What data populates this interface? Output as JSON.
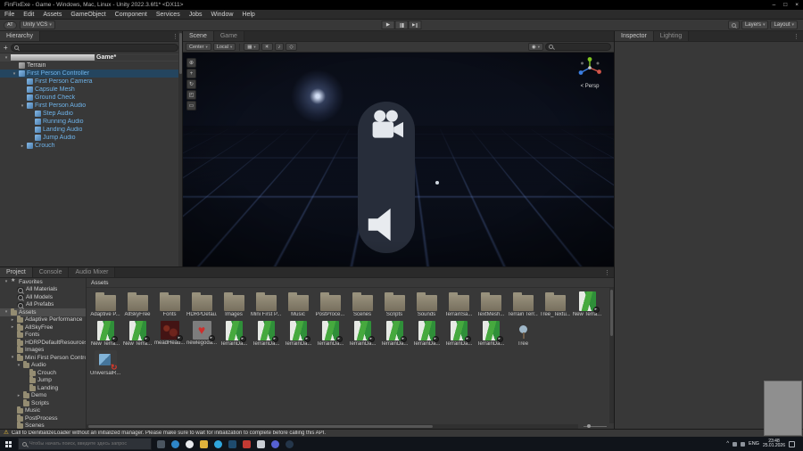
{
  "window": {
    "title": "FinFixExe - Game - Windows, Mac, Linux - Unity 2022.3.6f1* <DX11>",
    "controls": {
      "minimize": "–",
      "maximize": "□",
      "close": "×"
    },
    "menus": [
      "File",
      "Edit",
      "Assets",
      "GameObject",
      "Component",
      "Services",
      "Jobs",
      "Window",
      "Help"
    ]
  },
  "toolbar": {
    "account": "AT",
    "vcs": "Unity VCS",
    "layers": "Layers",
    "layout": "Layout"
  },
  "icons": {
    "play": "▶",
    "warning": "⚠",
    "more": "⋮",
    "grid": "▦",
    "lighting": "☀",
    "audio": "♪",
    "effects": "◇",
    "gizmos": "◉",
    "view_tool": "⊕",
    "move_tool": "+",
    "rotate_tool": "↻",
    "scale_tool": "◰",
    "rect_tool": "▭"
  },
  "hierarchy": {
    "tab": "Hierarchy",
    "add_button": "+",
    "items": [
      {
        "label": "Game*",
        "indent": 0,
        "arrow": "▾",
        "type": "scene",
        "color": "scene",
        "sel": "scenerow"
      },
      {
        "label": "Terrain",
        "indent": 1,
        "arrow": "",
        "type": "cube",
        "color": "plain"
      },
      {
        "label": "First Person Controller",
        "indent": 1,
        "arrow": "▾",
        "type": "prefab",
        "color": "prefab",
        "sel": "selrow"
      },
      {
        "label": "First Person Camera",
        "indent": 2,
        "arrow": "",
        "type": "prefab",
        "color": "prefab"
      },
      {
        "label": "Capsule Mesh",
        "indent": 2,
        "arrow": "",
        "type": "prefab",
        "color": "prefab"
      },
      {
        "label": "Ground Check",
        "indent": 2,
        "arrow": "",
        "type": "prefab",
        "color": "prefab"
      },
      {
        "label": "First Person Audio",
        "indent": 2,
        "arrow": "▾",
        "type": "prefab",
        "color": "prefab"
      },
      {
        "label": "Step Audio",
        "indent": 3,
        "arrow": "",
        "type": "prefab",
        "color": "prefab"
      },
      {
        "label": "Running Audio",
        "indent": 3,
        "arrow": "",
        "type": "prefab",
        "color": "prefab"
      },
      {
        "label": "Landing Audio",
        "indent": 3,
        "arrow": "",
        "type": "prefab",
        "color": "prefab"
      },
      {
        "label": "Jump Audio",
        "indent": 3,
        "arrow": "",
        "type": "prefab",
        "color": "prefab"
      },
      {
        "label": "Crouch",
        "indent": 2,
        "arrow": "▸",
        "type": "prefab",
        "color": "prefab"
      }
    ]
  },
  "scene": {
    "tabs": [
      {
        "label": "Scene",
        "state": "active"
      },
      {
        "label": "Game",
        "state": "inactive"
      }
    ],
    "pivot": "Center",
    "orientation": "Local",
    "gizmo_label": "< Persp"
  },
  "inspector": {
    "tabs": [
      {
        "label": "Inspector",
        "state": "active"
      },
      {
        "label": "Lighting",
        "state": "inactive"
      }
    ]
  },
  "project": {
    "tabs": [
      {
        "label": "Project",
        "state": "active"
      },
      {
        "label": "Console",
        "state": "inactive"
      },
      {
        "label": "Audio Mixer",
        "state": "inactive"
      }
    ],
    "breadcrumb": "Assets",
    "tree": [
      {
        "label": "Favorites",
        "indent": 0,
        "arrow": "▾",
        "icon": "star"
      },
      {
        "label": "All Materials",
        "indent": 1,
        "arrow": "",
        "icon": "search"
      },
      {
        "label": "All Models",
        "indent": 1,
        "arrow": "",
        "icon": "search"
      },
      {
        "label": "All Prefabs",
        "indent": 1,
        "arrow": "",
        "icon": "search"
      },
      {
        "label": "Assets",
        "indent": 0,
        "arrow": "▾",
        "icon": "folder",
        "sel": "selrow"
      },
      {
        "label": "Adaptive Performance",
        "indent": 1,
        "arrow": "▸",
        "icon": "folder"
      },
      {
        "label": "AllSkyFree",
        "indent": 1,
        "arrow": "▸",
        "icon": "folder"
      },
      {
        "label": "Fonts",
        "indent": 1,
        "arrow": "",
        "icon": "folder"
      },
      {
        "label": "HDRPDefaultResources",
        "indent": 1,
        "arrow": "",
        "icon": "folder"
      },
      {
        "label": "Images",
        "indent": 1,
        "arrow": "",
        "icon": "folder"
      },
      {
        "label": "Mini First Person Controls",
        "indent": 1,
        "arrow": "▾",
        "icon": "folder"
      },
      {
        "label": "Audio",
        "indent": 2,
        "arrow": "▾",
        "icon": "folder"
      },
      {
        "label": "Crouch",
        "indent": 3,
        "arrow": "",
        "icon": "folder"
      },
      {
        "label": "Jump",
        "indent": 3,
        "arrow": "",
        "icon": "folder"
      },
      {
        "label": "Landing",
        "indent": 3,
        "arrow": "",
        "icon": "folder"
      },
      {
        "label": "Demo",
        "indent": 2,
        "arrow": "▸",
        "icon": "folder"
      },
      {
        "label": "Scripts",
        "indent": 2,
        "arrow": "",
        "icon": "folder"
      },
      {
        "label": "Music",
        "indent": 1,
        "arrow": "",
        "icon": "folder"
      },
      {
        "label": "PostProcess",
        "indent": 1,
        "arrow": "",
        "icon": "folder"
      },
      {
        "label": "Scenes",
        "indent": 1,
        "arrow": "",
        "icon": "folder"
      }
    ],
    "row1": [
      {
        "label": "Adaptive P...",
        "type": "folder"
      },
      {
        "label": "AllSkyFree",
        "type": "folder"
      },
      {
        "label": "Fonts",
        "type": "folder"
      },
      {
        "label": "HDRPDefau...",
        "type": "folder"
      },
      {
        "label": "Images",
        "type": "folder"
      },
      {
        "label": "Mini First P...",
        "type": "folder"
      },
      {
        "label": "Music",
        "type": "folder"
      },
      {
        "label": "PostProce...",
        "type": "folder"
      },
      {
        "label": "Scenes",
        "type": "folder"
      },
      {
        "label": "Scripts",
        "type": "folder"
      },
      {
        "label": "Sounds",
        "type": "folder"
      },
      {
        "label": "TerrainSa...",
        "type": "folder"
      },
      {
        "label": "TextMesh...",
        "type": "folder"
      },
      {
        "label": "Terrain Terr...",
        "type": "folder"
      },
      {
        "label": "Tree_Textu...",
        "type": "folder"
      },
      {
        "label": "New Terra...",
        "type": "terrain",
        "badge": true
      }
    ],
    "row2": [
      {
        "label": "New Terra...",
        "type": "terrain",
        "badge": true
      },
      {
        "label": "New Terra...",
        "type": "terrain",
        "badge": true
      },
      {
        "label": "meadHead...",
        "type": "image-a",
        "badge": true
      },
      {
        "label": "newlegoda...",
        "type": "image-b",
        "badge": true
      },
      {
        "label": "TerrainDa...",
        "type": "terrain",
        "badge": true
      },
      {
        "label": "TerrainDa...",
        "type": "terrain",
        "badge": true
      },
      {
        "label": "TerrainDa...",
        "type": "terrain",
        "badge": true
      },
      {
        "label": "TerrainDa...",
        "type": "terrain",
        "badge": true
      },
      {
        "label": "TerrainDa...",
        "type": "terrain",
        "badge": true
      },
      {
        "label": "TerrainDa...",
        "type": "terrain",
        "badge": true
      },
      {
        "label": "TerrainDa...",
        "type": "terrain",
        "badge": true
      },
      {
        "label": "TerrainDa...",
        "type": "terrain",
        "badge": true
      },
      {
        "label": "TerrainDa...",
        "type": "terrain",
        "badge": true
      },
      {
        "label": "Tree",
        "type": "tree"
      }
    ],
    "row3": [
      {
        "label": "UniversalR...",
        "type": "pipeline"
      }
    ]
  },
  "status": {
    "warning": "Call to DeinitializeLoader without an initialized manager. Please make sure to wait for initialization to complete before calling this API."
  },
  "taskbar": {
    "search_placeholder": "Чтобы начать поиск, введите здесь запрос",
    "apps": [
      {
        "name": "task-view-icon",
        "color": "#4a5560",
        "shape": "square"
      },
      {
        "name": "edge-browser-icon",
        "color": "#2e86c8",
        "shape": "circle"
      },
      {
        "name": "browser-icon",
        "color": "#e8eaed",
        "shape": "circle"
      },
      {
        "name": "file-explorer-icon",
        "color": "#dfb23c",
        "shape": "square"
      },
      {
        "name": "telegram-icon",
        "color": "#2fa6dc",
        "shape": "circle"
      },
      {
        "name": "photoshop-icon",
        "color": "#1e4b6e",
        "shape": "square"
      },
      {
        "name": "media-player-icon",
        "color": "#c23a33",
        "shape": "square"
      },
      {
        "name": "unity-hub-icon",
        "color": "#c9ced4",
        "shape": "square"
      },
      {
        "name": "discord-icon",
        "color": "#5661d2",
        "shape": "circle"
      },
      {
        "name": "game-launcher-icon",
        "color": "#24364a",
        "shape": "circle"
      }
    ],
    "tray": {
      "expand": "^",
      "lang": "ENG",
      "time": "23:48",
      "date": "25.01.2026"
    }
  },
  "colors": {
    "selection_blue": "#24455f",
    "prefab_text": "#6eb2e8",
    "warning_yellow": "#f2c43c",
    "grid_blue": "#5f7ec6"
  }
}
